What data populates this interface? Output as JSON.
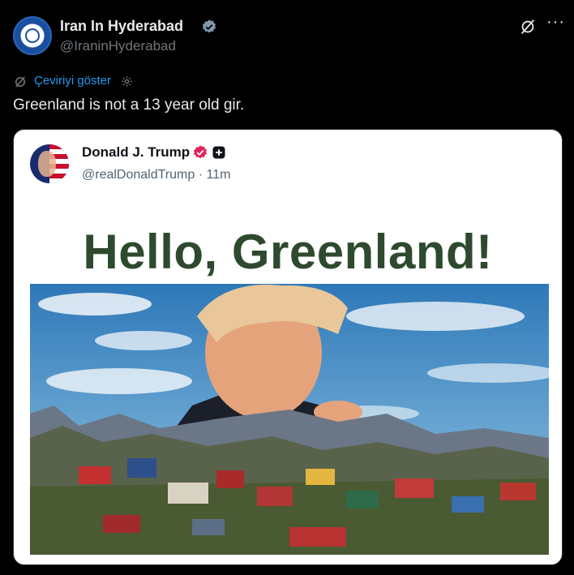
{
  "post": {
    "author_name": "Iran In Hyderabad",
    "author_handle": "@IraninHyderabad",
    "translate_label": "Çeviriyi göster",
    "text": "Greenland is not a 13 year old gir."
  },
  "embedded": {
    "author_name": "Donald J. Trump",
    "author_handle": "@realDonaldTrump · 11m",
    "headline": "Hello, Greenland!"
  },
  "icons": {
    "verified": "verified-badge-icon",
    "grok": "grok-icon",
    "more": "more-icon",
    "translate": "translate-icon",
    "settings": "gear-icon"
  },
  "colors": {
    "background": "#000000",
    "text": "#e7e9ea",
    "muted": "#71767b",
    "link": "#1d9bf0",
    "headline": "#2e4a2e",
    "verified_gray": "#829aab",
    "verified_pink": "#e0245e"
  }
}
